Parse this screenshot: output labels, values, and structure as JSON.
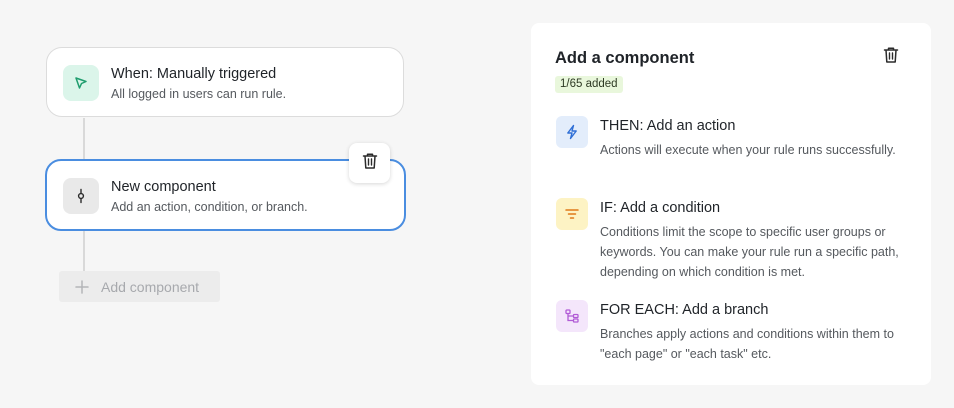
{
  "flow": {
    "trigger": {
      "title": "When: Manually triggered",
      "subtitle": "All logged in users can run rule.",
      "icon": "cursor-click-icon",
      "icon_color": "#1f9d6e"
    },
    "new_component": {
      "title": "New component",
      "subtitle": "Add an action, condition, or branch.",
      "icon": "component-icon",
      "selected_border_color": "#4a8de0"
    },
    "delete_icon": "trash-icon",
    "add_component_label": "Add component"
  },
  "panel": {
    "title": "Add a component",
    "count_badge": "1/65 added",
    "delete_icon": "trash-icon",
    "options": [
      {
        "title": "THEN: Add an action",
        "description": "Actions will execute when your rule runs successfully.",
        "icon": "lightning-icon",
        "icon_color": "#2f6fd6"
      },
      {
        "title": "IF: Add a condition",
        "description": "Conditions limit the scope to specific user groups or keywords. You can make your rule run a specific path, depending on which condition is met.",
        "icon": "filter-lines-icon",
        "icon_color": "#e07b1a"
      },
      {
        "title": "FOR EACH: Add a branch",
        "description": "Branches apply actions and conditions within them to \"each page\" or \"each task\" etc.",
        "icon": "branch-icon",
        "icon_color": "#b15bd6"
      }
    ]
  }
}
